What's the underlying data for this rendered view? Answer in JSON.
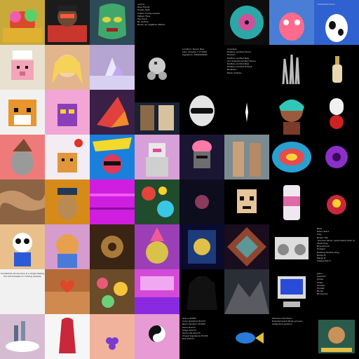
{
  "tiles": [
    {
      "name": "neon-tree-landscape",
      "bg": "#c9a93a"
    },
    {
      "name": "ape-train-conductor",
      "bg": "#1b1b1b"
    },
    {
      "name": "luchador-mask-portrait",
      "bg": "#2d4a57"
    },
    {
      "name": "trait-list-text-1",
      "bg": "#000000",
      "text": "Aurora\nRare Hands\nTrades Hats\nCotton Candy Leaves\nMeteor Face\nTop Hand\nNo Outline\nBrown all negative effects"
    },
    {
      "name": "black-empty-1",
      "bg": "#000000"
    },
    {
      "name": "vinyl-record-cover",
      "bg": "#0e0e0e"
    },
    {
      "name": "pink-creature-blue-bg",
      "bg": "#4a7ed6"
    },
    {
      "name": "cow-character-blue",
      "bg": "#2f62d0",
      "text": "TheNewFactotum"
    },
    {
      "name": "pixel-pig-chef",
      "bg": "#e8e1cf"
    },
    {
      "name": "blonde-girl-portrait",
      "bg": "#e2b58c"
    },
    {
      "name": "crystal-cloudscape",
      "bg": "#b6a4d3"
    },
    {
      "name": "chrome-ball-figure",
      "bg": "#000000"
    },
    {
      "name": "trait-list-text-2",
      "bg": "#000000",
      "text": "Location: Seven Rain\nsize: 16 adds 7 of 2000\nSignature: 1000000000"
    },
    {
      "name": "trait-list-text-3",
      "bg": "#000000",
      "text": "Colorless\nEarthen Limited Stone\nHorizon\nEarthen Limited Bwe\nSun Inspired Limited Stone\nEarthen Limited Bwe\nEarthen Limited Octave\nNowhere\nBlack Clothes"
    },
    {
      "name": "silver-claw-hand",
      "bg": "#000000"
    },
    {
      "name": "perfume-bottle",
      "bg": "#000000"
    },
    {
      "name": "pixel-fox",
      "bg": "#f1f1f1"
    },
    {
      "name": "pixel-purple-blob",
      "bg": "#f2a6d6"
    },
    {
      "name": "geometric-arrow-purple",
      "bg": "#3a2046"
    },
    {
      "name": "star-wars-collage",
      "bg": "#1a2233"
    },
    {
      "name": "alien-sunglasses",
      "bg": "#000000"
    },
    {
      "name": "single-star-dark",
      "bg": "#000000"
    },
    {
      "name": "teal-helmet-woman",
      "bg": "#000000"
    },
    {
      "name": "pill-capsules",
      "bg": "#000000"
    },
    {
      "name": "gray-dog-wizard-hat",
      "bg": "#ef7a7a"
    },
    {
      "name": "pixel-bear-balloon",
      "bg": "#f3ecf2"
    },
    {
      "name": "comic-superhero-pop",
      "bg": "#1b7fdc"
    },
    {
      "name": "pink-robot-suit",
      "bg": "#d8a0d8"
    },
    {
      "name": "knight-brain-helmet",
      "bg": "#1a1632"
    },
    {
      "name": "two-women-photo",
      "bg": "#7c8b90"
    },
    {
      "name": "swirl-abstract",
      "bg": "#000000"
    },
    {
      "name": "purple-sun-burst",
      "bg": "#000000"
    },
    {
      "name": "brown-texture-abstract",
      "bg": "#8c6443"
    },
    {
      "name": "dog-police-officer",
      "bg": "#d68a1a"
    },
    {
      "name": "magenta-glitch-texture",
      "bg": "#d01ee0"
    },
    {
      "name": "psychedelic-pattern",
      "bg": "#204b2c"
    },
    {
      "name": "planet-dark-space",
      "bg": "#0d0d1e"
    },
    {
      "name": "pixel-skull-face",
      "bg": "#000000"
    },
    {
      "name": "pink-soda-can",
      "bg": "#000000"
    },
    {
      "name": "red-robot-creature",
      "bg": "#000000"
    },
    {
      "name": "superman-panda",
      "bg": "#e9c08c"
    },
    {
      "name": "shiba-dog-costume",
      "bg": "#d69ccd"
    },
    {
      "name": "steampunk-machine",
      "bg": "#3a2414"
    },
    {
      "name": "party-ape-portrait",
      "bg": "#9b3fb6"
    },
    {
      "name": "cosmic-card-portrait",
      "bg": "#0b0b2e"
    },
    {
      "name": "fractal-kaleidoscope",
      "bg": "#1a0d1d"
    },
    {
      "name": "boombox-sketch",
      "bg": "#000000"
    },
    {
      "name": "trait-list-text-4",
      "bg": "#000000",
      "text": "Base\nDawn Stars\nClay\nBrown Hat\n\"Sunrise Vamp\" Serendipity Moth of Stretching\nBlue Shovel\nProblem\nBobbing Bubble Ring\nBobby B\nMargo B\nLeadership H"
    },
    {
      "name": "pink-puddle-text",
      "bg": "#f1f1f1",
      "text": "Sometimes all we have is a single feeling\nthe world keeps on moving anyway"
    },
    {
      "name": "orange-hearts-lake",
      "bg": "#b46b38"
    },
    {
      "name": "flower-collage",
      "bg": "#6a4b2a"
    },
    {
      "name": "vaporwave-text-art",
      "bg": "#d44ad8"
    },
    {
      "name": "black-hoodie",
      "bg": "#000000"
    },
    {
      "name": "mountain-cliff-photo",
      "bg": "#2a2e36"
    },
    {
      "name": "pixel-retro-computer",
      "bg": "#000000"
    },
    {
      "name": "word-list-text",
      "bg": "#000000",
      "text": "Jesus\nSalvador\nJames\nSober\nSavage\nHonest\nBones\nBorderline"
    },
    {
      "name": "floating-city-clouds",
      "bg": "#d6bcd2"
    },
    {
      "name": "red-liquid-figure",
      "bg": "#f6f6f6"
    },
    {
      "name": "grapes-sunset",
      "bg": "#f2b39c"
    },
    {
      "name": "yin-yang-pink",
      "bg": "#e79ad3"
    },
    {
      "name": "trait-list-text-5",
      "bg": "#000000",
      "text": "Grace #7987\nColor Gradient #1273\nNeon Vacation #1090\nDash #1273\nStage #1273\nHardcode #1273\nClosed Signature #1320\nExit #1273"
    },
    {
      "name": "tropical-fish",
      "bg": "#000000"
    },
    {
      "name": "trait-list-text-6",
      "bg": "#000000",
      "text": "Television Brothers\nEntertainment Mode process\nexpanding seasons"
    },
    {
      "name": "hero-album-cover",
      "bg": "#000000"
    }
  ]
}
